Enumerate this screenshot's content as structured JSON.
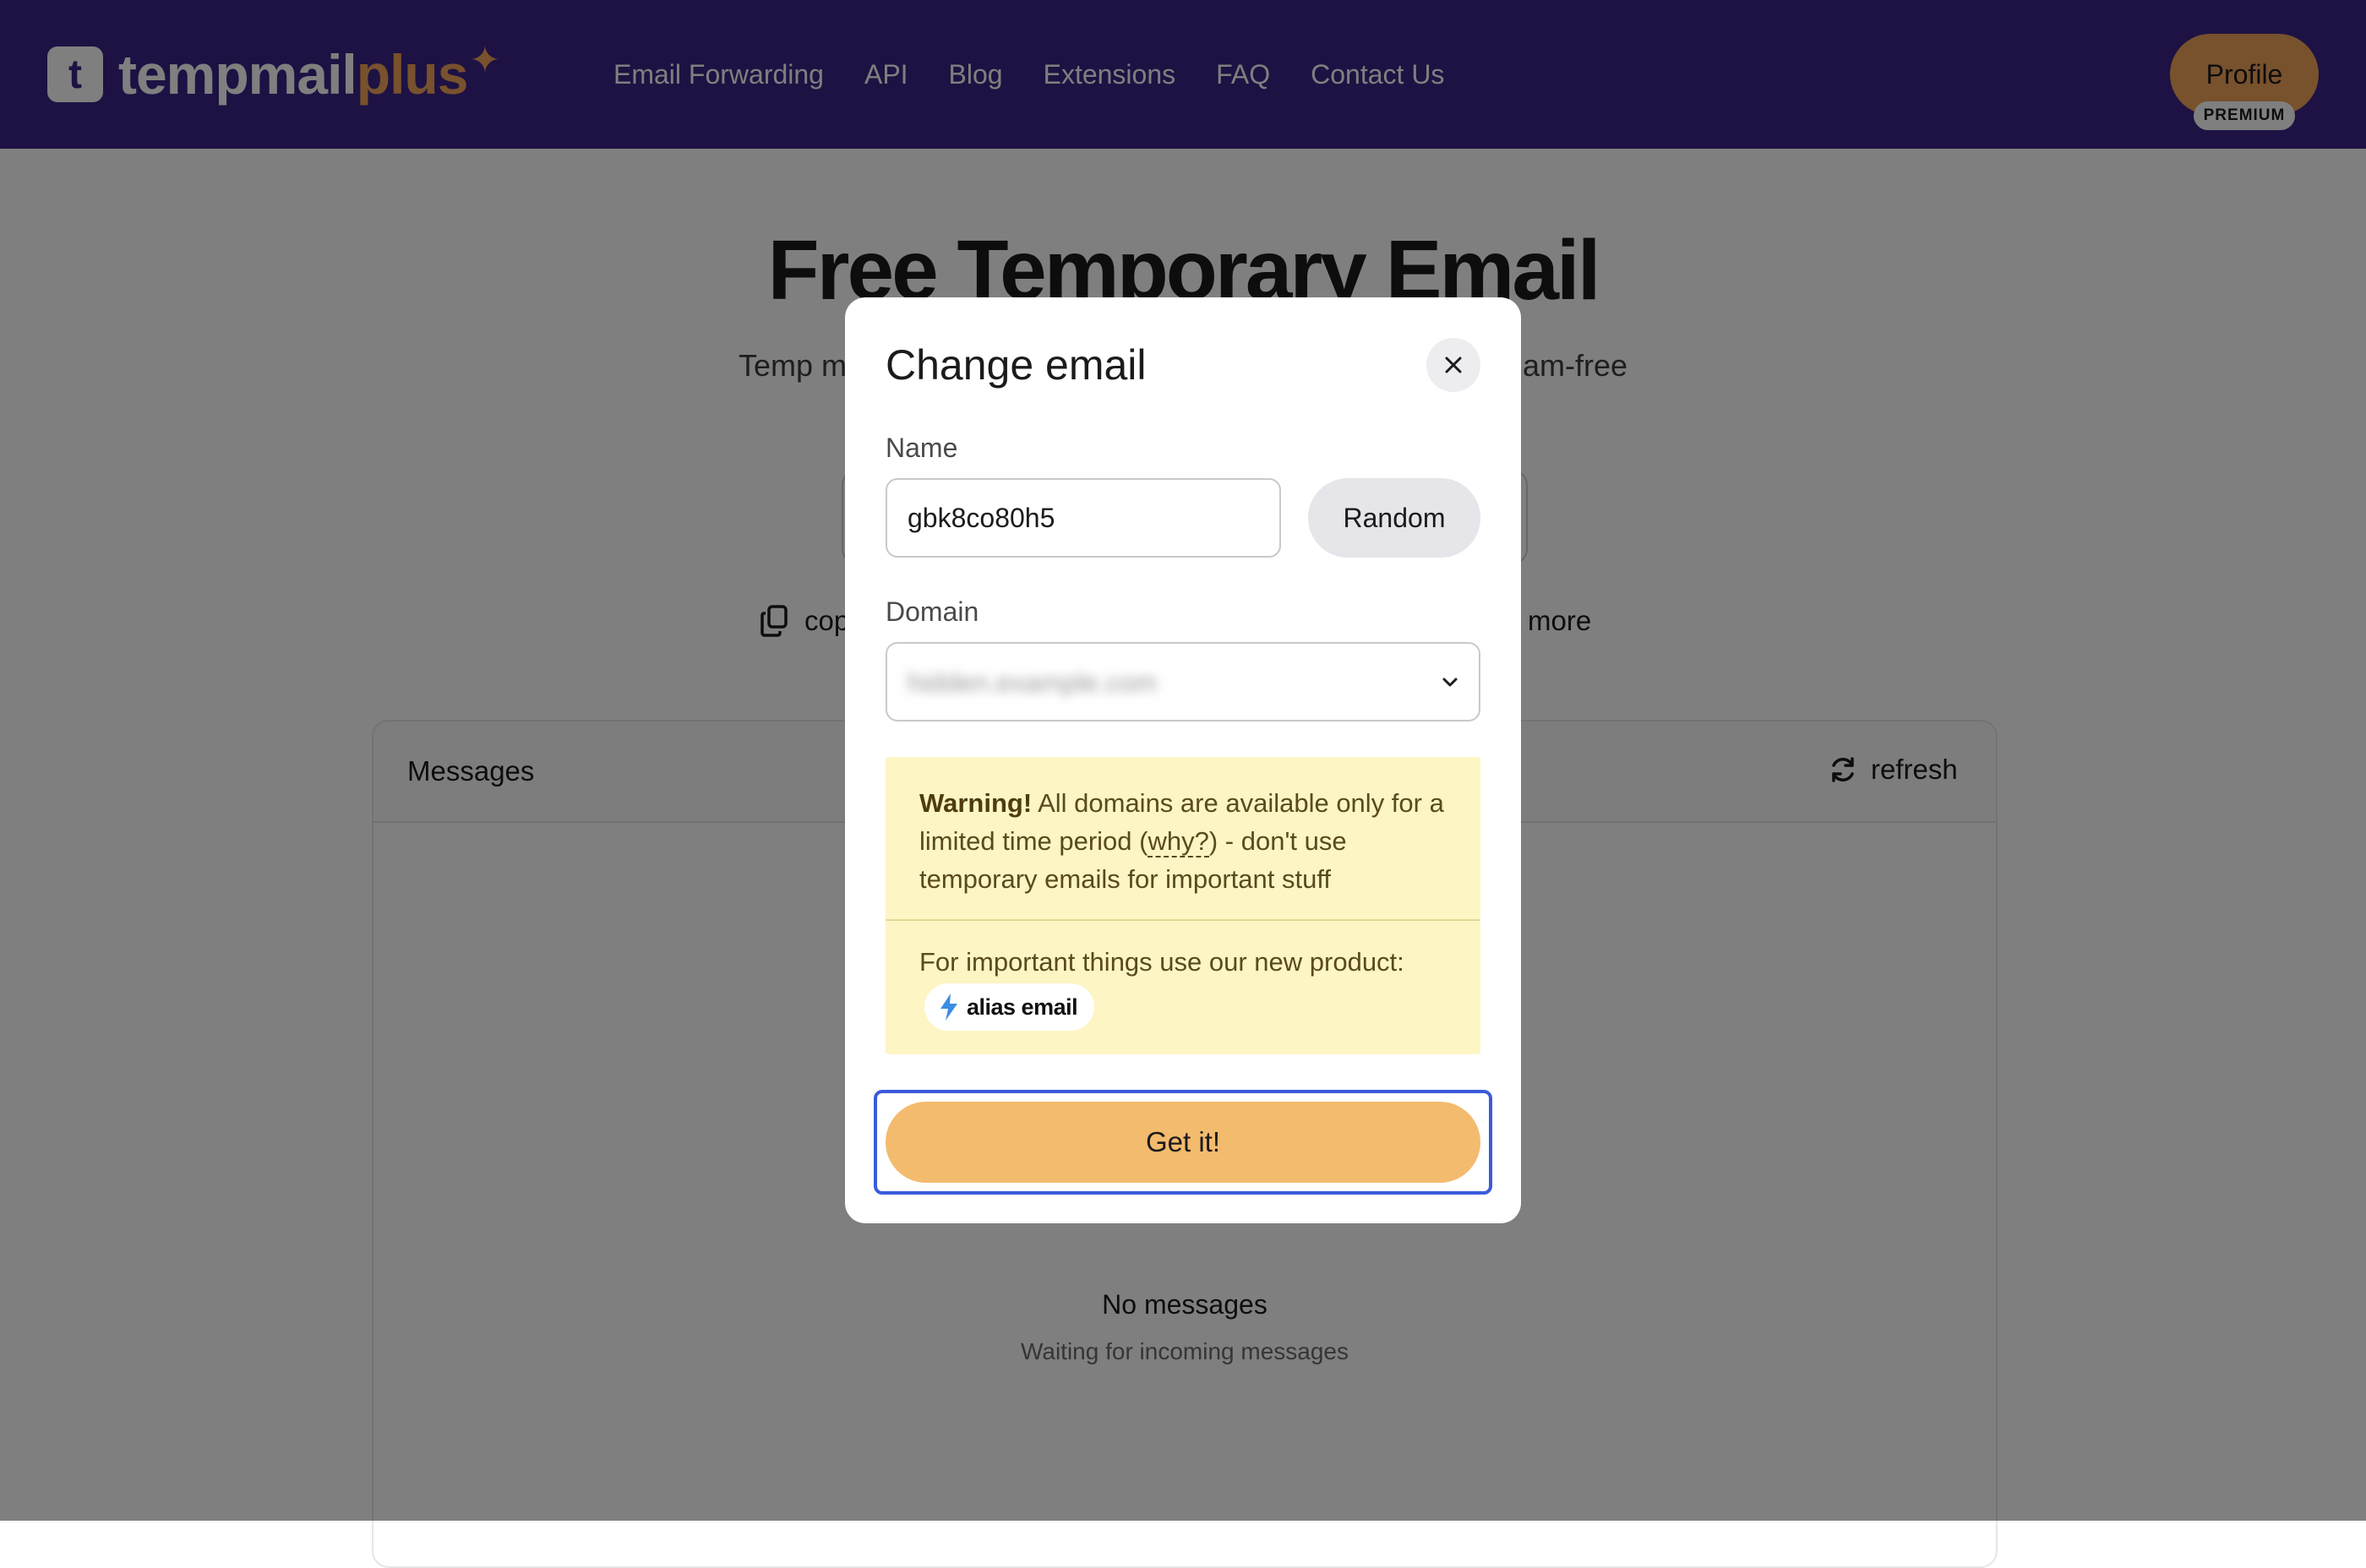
{
  "header": {
    "logo_letter": "t",
    "logo_text_main": "tempmail",
    "logo_text_accent": "plus",
    "nav": [
      {
        "label": "Email Forwarding"
      },
      {
        "label": "API"
      },
      {
        "label": "Blog"
      },
      {
        "label": "Extensions"
      },
      {
        "label": "FAQ"
      },
      {
        "label": "Contact Us"
      }
    ],
    "profile_label": "Profile",
    "premium_label": "PREMIUM"
  },
  "hero": {
    "title": "Free Temporary Email",
    "subtitle": "Temp m",
    "subtitle_tail": "am-free"
  },
  "actions": {
    "copy_label": "cop",
    "more_label": "more"
  },
  "messages": {
    "title": "Messages",
    "refresh_label": "refresh",
    "empty_title": "No messages",
    "empty_subtitle": "Waiting for incoming messages"
  },
  "modal": {
    "title": "Change email",
    "name_label": "Name",
    "name_value": "gbk8co80h5",
    "random_label": "Random",
    "domain_label": "Domain",
    "domain_value": "hidden.example.com",
    "warning": {
      "strong": "Warning!",
      "text_before_link": " All domains are available only for a limited time period (",
      "link": "why?",
      "text_after_link": ") - don't use temporary emails for important stuff",
      "promo_text": "For important things use our new product:",
      "product_name": "alias email"
    },
    "submit_label": "Get it!"
  },
  "colors": {
    "header_bg": "#3a2586",
    "accent_orange": "#f0a25a",
    "button_orange": "#f3bb6e",
    "warning_bg": "#fdf5c4",
    "focus_blue": "#3b5bdb"
  },
  "icons": {
    "copy": "copy-icon",
    "more": "dots-icon",
    "refresh": "refresh-icon",
    "close": "close-icon",
    "chevron": "chevron-down-icon",
    "alias": "bolt-icon"
  }
}
